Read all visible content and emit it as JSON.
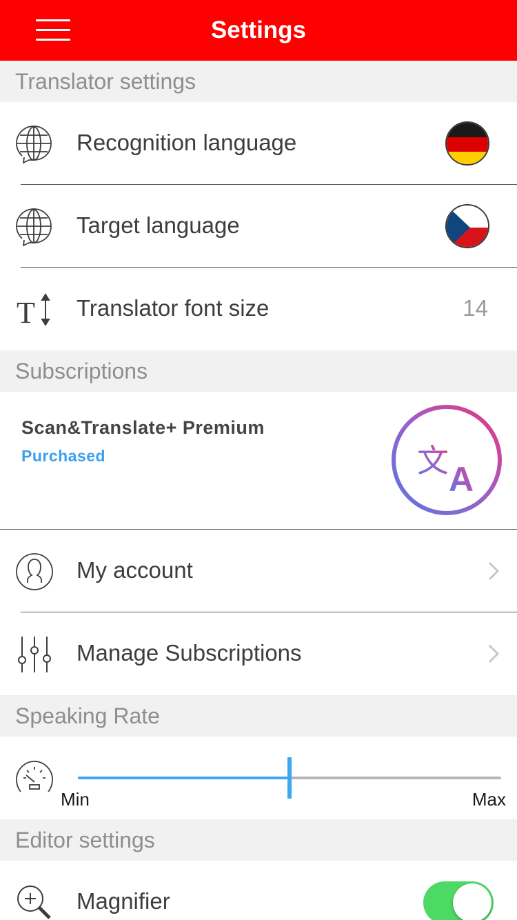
{
  "navbar": {
    "title": "Settings",
    "menu_icon": "hamburger-menu-icon",
    "background": "#fe0000"
  },
  "translator_settings": {
    "header": "Translator settings",
    "recognition_language": {
      "label": "Recognition language",
      "icon": "globe-chat-icon",
      "flag": "germany-flag"
    },
    "target_language": {
      "label": "Target language",
      "icon": "globe-chat-icon",
      "flag": "czech-flag"
    },
    "font_size": {
      "label": "Translator font size",
      "icon": "text-size-icon",
      "value": "14"
    }
  },
  "subscriptions": {
    "header": "Subscriptions",
    "premium": {
      "title": "Scan&Translate+ Premium",
      "status": "Purchased",
      "status_color": "#3b9ff0",
      "logo": "translate-logo-icon"
    },
    "my_account": {
      "label": "My account",
      "icon": "user-icon"
    },
    "manage": {
      "label": "Manage Subscriptions",
      "icon": "sliders-icon"
    }
  },
  "speaking_rate": {
    "header": "Speaking Rate",
    "icon": "speedometer-icon",
    "min_label": "Min",
    "max_label": "Max",
    "value": 0.5,
    "accent": "#3ba8f2"
  },
  "editor_settings": {
    "header": "Editor settings",
    "magnifier": {
      "label": "Magnifier",
      "icon": "magnifier-zoom-icon",
      "enabled": true,
      "toggle_color": "#4cd964"
    }
  }
}
